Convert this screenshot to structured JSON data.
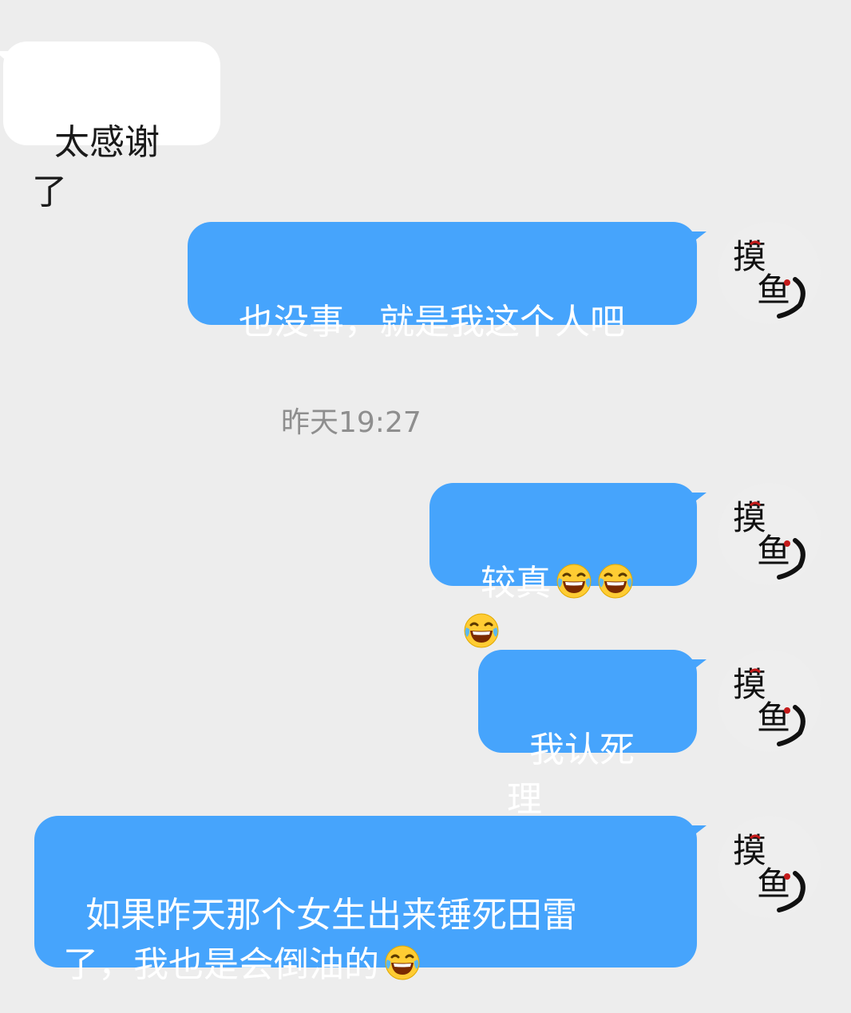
{
  "conversation": {
    "messages": [
      {
        "from": "contact",
        "text": "太感谢了"
      },
      {
        "from": "me",
        "text": "也没事，就是我这个人吧"
      },
      {
        "from": "me",
        "text": "较真",
        "emoji": [
          "laughing-crying-emoji",
          "laughing-crying-emoji",
          "laughing-crying-emoji"
        ]
      },
      {
        "from": "me",
        "text": "我认死理"
      },
      {
        "from": "me",
        "text": "如果昨天那个女生出来锤死田雷\n了，我也是会倒油的",
        "emoji": [
          "laughing-crying-emoji"
        ]
      }
    ],
    "timestamp": "昨天19:27"
  },
  "avatar": {
    "icon": "fish-ink-calligraphy-avatar",
    "text": "摸鱼"
  },
  "colors": {
    "background": "#ededed",
    "sent_bubble": "#46a4fc",
    "received_bubble": "#ffffff",
    "timestamp_text": "#8e8e8e"
  }
}
